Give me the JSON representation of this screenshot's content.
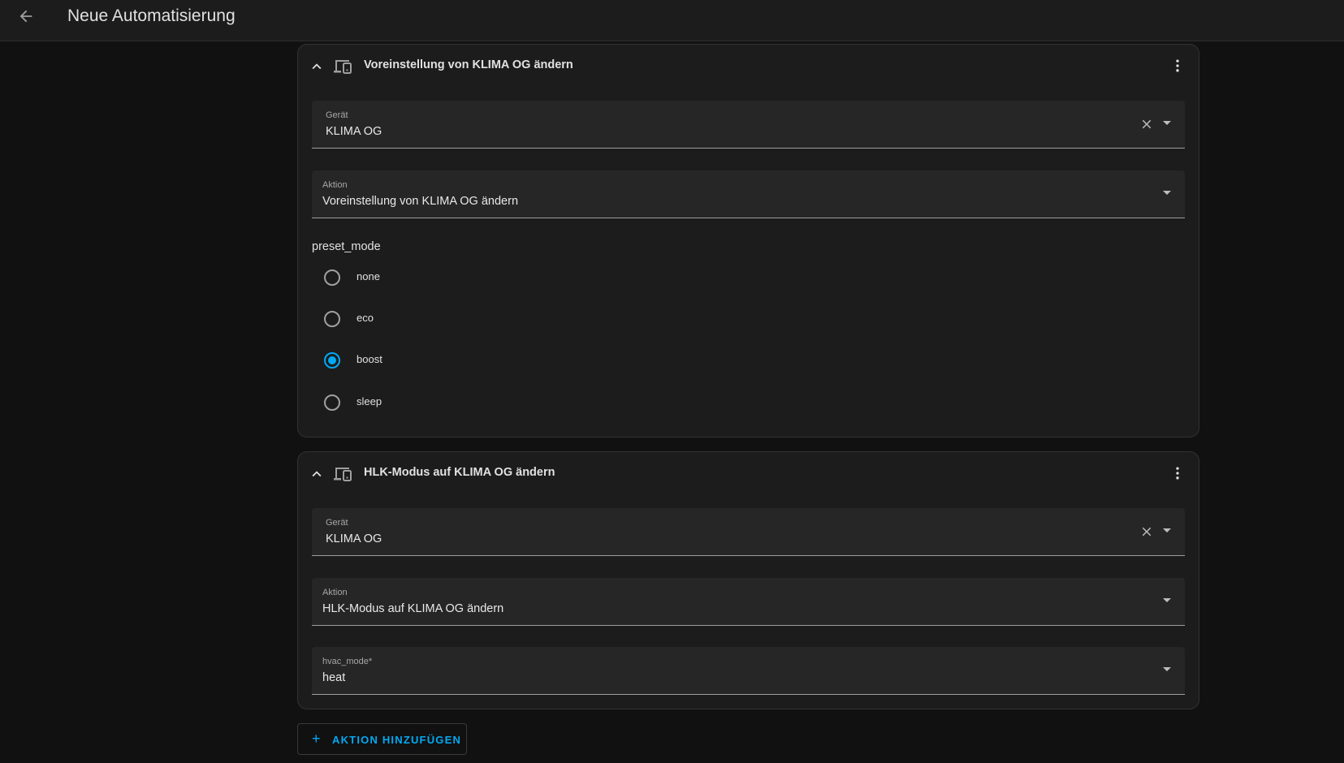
{
  "header": {
    "title": "Neue Automatisierung",
    "back_icon": "arrow-left-icon"
  },
  "cards": [
    {
      "title": "Voreinstellung von KLIMA OG ändern",
      "device_field": {
        "label": "Gerät",
        "value": "KLIMA OG"
      },
      "action_field": {
        "label": "Aktion",
        "value": "Voreinstellung von KLIMA OG ändern"
      },
      "preset_mode": {
        "label": "preset_mode",
        "options": [
          "none",
          "eco",
          "boost",
          "sleep"
        ],
        "selected": "boost"
      }
    },
    {
      "title": "HLK-Modus auf KLIMA OG ändern",
      "device_field": {
        "label": "Gerät",
        "value": "KLIMA OG"
      },
      "action_field": {
        "label": "Aktion",
        "value": "HLK-Modus auf KLIMA OG ändern"
      },
      "hvac_field": {
        "label": "hvac_mode*",
        "value": "heat"
      }
    }
  ],
  "add_action_button": {
    "label": "AKTION HINZUFÜGEN"
  },
  "colors": {
    "accent": "#03a9f4",
    "background": "#111111",
    "card": "#1c1c1c",
    "field": "#262626"
  }
}
